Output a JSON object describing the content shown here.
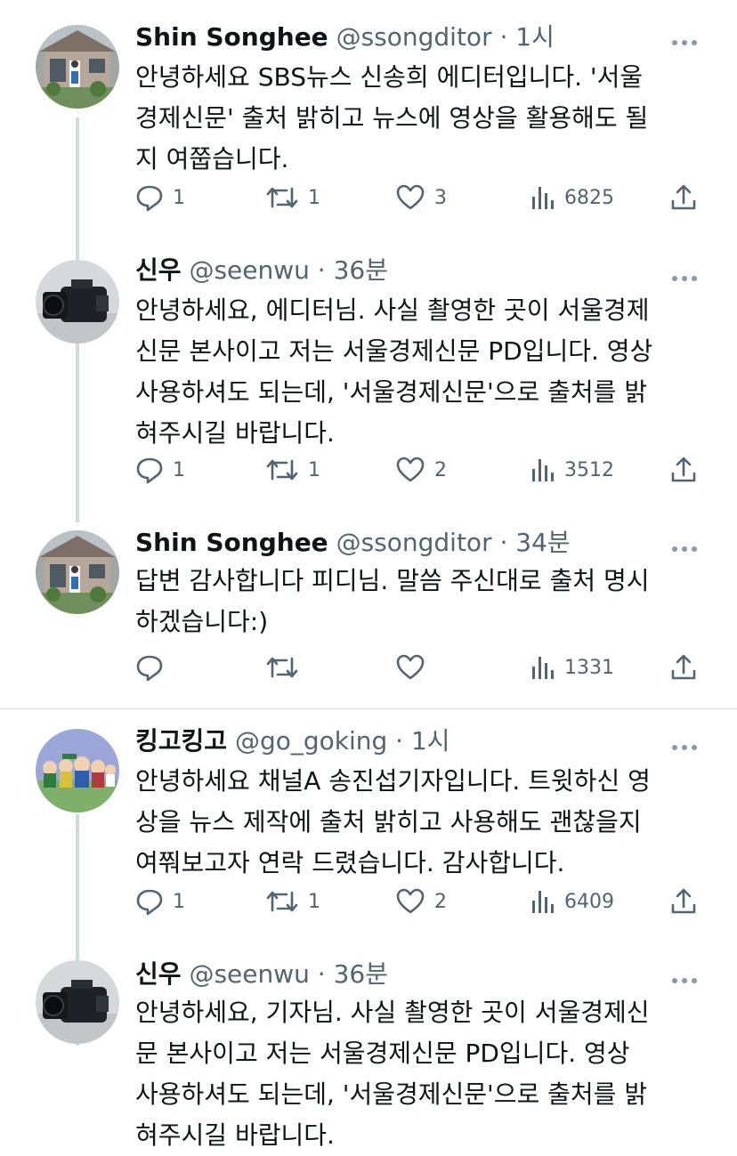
{
  "threads": [
    {
      "tweets": [
        {
          "name": "Shin Songhee",
          "handle": "@ssongditor",
          "time": "1시",
          "avatar": "house-photo-avatar",
          "lines": [
            "안녕하세요 SBS뉴스 신송희 에디터입니다. '서울",
            "경제신문' 출처 밝히고 뉴스에 영상을 활용해도 될",
            "지 여쭙습니다."
          ],
          "replies": "1",
          "retweets": "1",
          "likes": "3",
          "views": "6825"
        },
        {
          "name": "신우",
          "handle": "@seenwu",
          "time": "36분",
          "avatar": "camera-photo-avatar",
          "lines": [
            "안녕하세요, 에디터님. 사실 촬영한 곳이 서울경제",
            "신문 본사이고 저는 서울경제신문 PD입니다. 영상",
            "사용하셔도 되는데, '서울경제신문'으로 출처를 밝",
            "혀주시길 바랍니다."
          ],
          "replies": "1",
          "retweets": "1",
          "likes": "2",
          "views": "3512"
        },
        {
          "name": "Shin Songhee",
          "handle": "@ssongditor",
          "time": "34분",
          "avatar": "house-photo-avatar",
          "lines": [
            "답변 감사합니다 피디님. 말씀 주신대로 출처 명시",
            "하겠습니다:)"
          ],
          "replies": "",
          "retweets": "",
          "likes": "",
          "views": "1331"
        }
      ]
    },
    {
      "tweets": [
        {
          "name": "킹고킹고",
          "handle": "@go_goking",
          "time": "1시",
          "avatar": "cartoon-characters-avatar",
          "lines": [
            "안녕하세요 채널A 송진섭기자입니다. 트윗하신 영",
            "상을 뉴스 제작에 출처 밝히고 사용해도 괜찮을지",
            "여쭤보고자 연락 드렸습니다. 감사합니다."
          ],
          "replies": "1",
          "retweets": "1",
          "likes": "2",
          "views": "6409"
        },
        {
          "name": "신우",
          "handle": "@seenwu",
          "time": "36분",
          "avatar": "camera-photo-avatar",
          "lines": [
            "안녕하세요, 기자님. 사실 촬영한 곳이 서울경제신",
            "문 본사이고 저는 서울경제신문 PD입니다. 영상",
            "사용하셔도 되는데, '서울경제신문'으로 출처를 밝",
            "혀주시길 바랍니다."
          ],
          "replies": "",
          "retweets": "",
          "likes": "",
          "views": ""
        }
      ]
    }
  ],
  "colors": {
    "text": "#0f1419",
    "muted": "#536471",
    "thread_line": "#cfd9de",
    "divider": "#d7dde2"
  }
}
